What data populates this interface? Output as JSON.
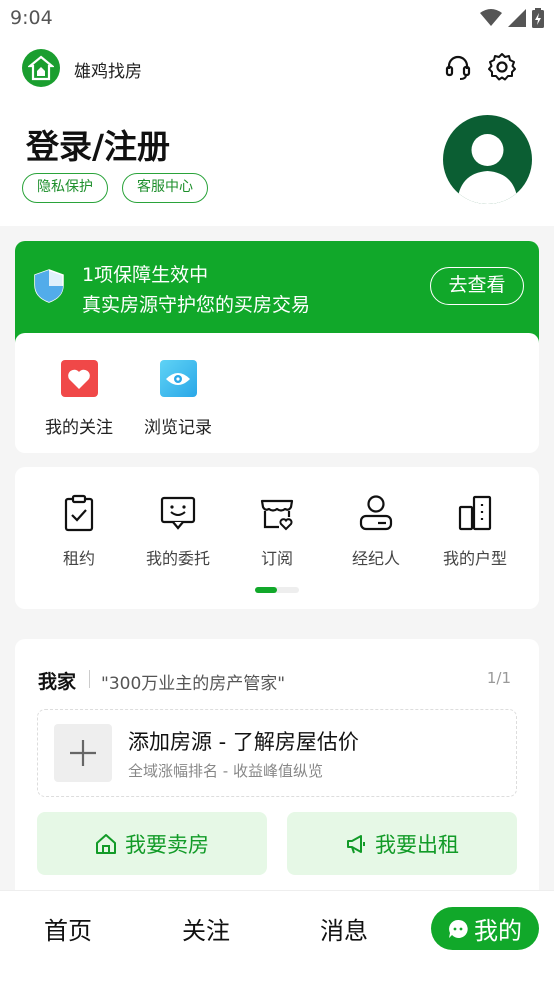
{
  "status_bar": {
    "time": "9:04"
  },
  "header": {
    "app_name": "雄鸡找房",
    "login_title": "登录/注册",
    "privacy_label": "隐私保护",
    "service_label": "客服中心"
  },
  "guarantee": {
    "line1": "1项保障生效中",
    "line2": "真实房源守护您的买房交易",
    "button_label": "去查看"
  },
  "quick_links": [
    {
      "label": "我的关注",
      "icon": "heart-icon"
    },
    {
      "label": "浏览记录",
      "icon": "eye-icon"
    }
  ],
  "tools": [
    {
      "label": "租约",
      "icon": "clipboard-check-icon"
    },
    {
      "label": "我的委托",
      "icon": "smile-board-icon"
    },
    {
      "label": "订阅",
      "icon": "store-heart-icon"
    },
    {
      "label": "经纪人",
      "icon": "agent-icon"
    },
    {
      "label": "我的户型",
      "icon": "building-icon"
    }
  ],
  "home": {
    "title": "我家",
    "subtitle": "\"300万业主的房产管家\"",
    "count": "1/1",
    "add_title": "添加房源 - 了解房屋估价",
    "add_sub": "全域涨幅排名 - 收益峰值纵览",
    "sell_label": "我要卖房",
    "rent_label": "我要出租"
  },
  "tabbar": {
    "tabs": [
      "首页",
      "关注",
      "消息"
    ],
    "active": "我的"
  },
  "colors": {
    "brand": "#11a82a",
    "avatar": "#0b5e33"
  }
}
